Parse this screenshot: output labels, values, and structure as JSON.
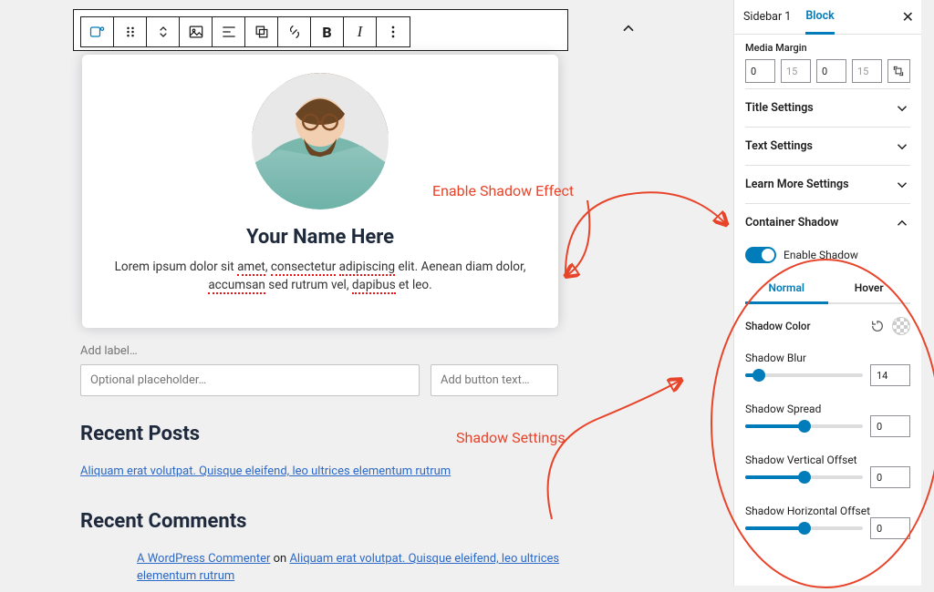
{
  "tabs": {
    "sidebar_tab": "Sidebar 1",
    "block_tab": "Block"
  },
  "media_margin": {
    "label": "Media Margin",
    "v1": "0",
    "v2": "15",
    "v3": "0",
    "v4": "15"
  },
  "panels": {
    "title": "Title Settings",
    "text": "Text Settings",
    "learn": "Learn More Settings",
    "shadow": "Container Shadow"
  },
  "shadow": {
    "enable_label": "Enable Shadow",
    "tab_normal": "Normal",
    "tab_hover": "Hover",
    "color_label": "Shadow Color",
    "blur_label": "Shadow Blur",
    "blur_val": "14",
    "spread_label": "Shadow Spread",
    "spread_val": "0",
    "voff_label": "Shadow Vertical Offset",
    "voff_val": "0",
    "hoff_label": "Shadow Horizontal Offset",
    "hoff_val": "0"
  },
  "card": {
    "title": "Your Name Here",
    "desc_pre": "Lorem ipsum dolor sit ",
    "amet": "amet",
    "mid1": ", ",
    "cons": "consectetur",
    "mid2": " ",
    "adip": "adipiscing",
    "mid3": " elit. Aenean diam dolor, ",
    "acc": "accumsan",
    "mid4": " sed rutrum vel, ",
    "dap": "dapibus",
    "desc_post": " et leo."
  },
  "below": {
    "label_prompt": "Add label…",
    "ph1": "Optional placeholder…",
    "ph2": "Add button text…",
    "recent_posts": "Recent Posts",
    "rp_link": "Aliquam erat volutpat. Quisque eleifend, leo ultrices elementum rutrum",
    "recent_comments": "Recent Comments",
    "rc_link1": "A WordPress Commenter",
    "rc_on": " on ",
    "rc_link2": "Aliquam erat volutpat. Quisque eleifend, leo ultrices elementum rutrum"
  },
  "annotations": {
    "enable": "Enable Shadow Effect",
    "settings": "Shadow Settings"
  }
}
